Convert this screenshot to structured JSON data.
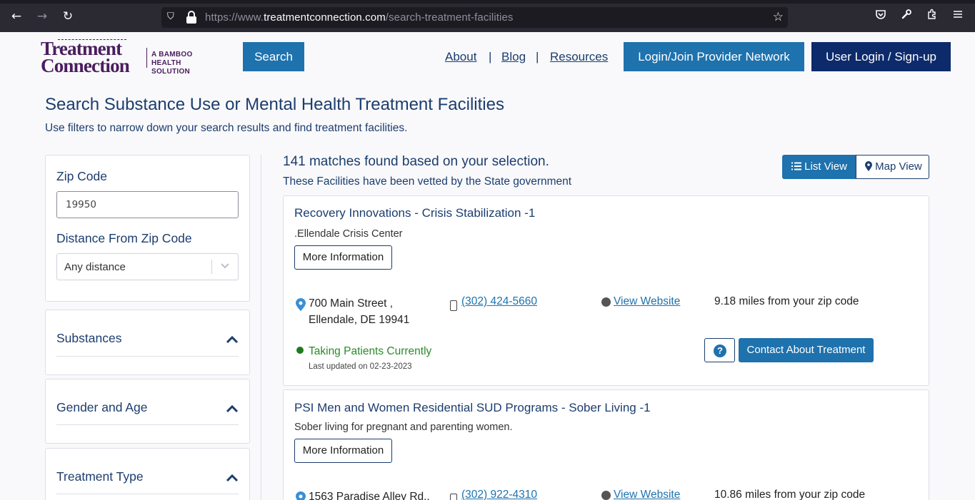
{
  "browser": {
    "back_icon": "←",
    "forward_icon": "→",
    "reload_icon": "↻",
    "url_prefix": "https://www.",
    "url_host": "treatmentconnection.com",
    "url_path": "/search-treatment-facilities",
    "bookmark_icon": "☆"
  },
  "header": {
    "logo_line1": "Treatment",
    "logo_line2": "Connection",
    "logo_sub1": "A BAMBOO HEALTH",
    "logo_sub2": "SOLUTION",
    "search_label": "Search",
    "about_label": "About",
    "blog_label": "Blog",
    "resources_label": "Resources",
    "separator": "|",
    "provider_label": "Login/Join Provider Network",
    "user_label": "User Login / Sign-up"
  },
  "page": {
    "title": "Search Substance Use or Mental Health Treatment Facilities",
    "subtitle": "Use filters to narrow down your search results and find treatment facilities."
  },
  "filters": {
    "zip_label": "Zip Code",
    "zip_value": "19950",
    "distance_label": "Distance From Zip Code",
    "distance_value": "Any distance",
    "accordions": [
      "Substances",
      "Gender and Age",
      "Treatment Type"
    ]
  },
  "results": {
    "matches_text": "141 matches found based on your selection.",
    "vetted_text": "These Facilities have been vetted by the State government",
    "list_view_label": "List View",
    "map_view_label": "Map View",
    "more_info_label": "More Information",
    "contact_label": "Contact About Treatment",
    "help_label": "?",
    "facilities": [
      {
        "name": "Recovery Innovations - Crisis Stabilization -1",
        "description": ".Ellendale Crisis Center",
        "address_line1": "700 Main Street ,",
        "address_line2": "Ellendale, DE 19941",
        "phone": "(302) 424-5660",
        "website_label": "View Website",
        "distance": "9.18 miles from your zip code",
        "status": "Taking Patients Currently",
        "updated": "Last updated on 02-23-2023"
      },
      {
        "name": "PSI Men and Women Residential SUD Programs - Sober Living -1",
        "description": "Sober living for pregnant and parenting women.",
        "address_line1": "1563 Paradise Alley Rd.,",
        "address_line2": "",
        "phone": "(302) 922-4310",
        "website_label": "View Website",
        "distance": "10.86 miles from your zip code",
        "status": "",
        "updated": ""
      }
    ]
  }
}
